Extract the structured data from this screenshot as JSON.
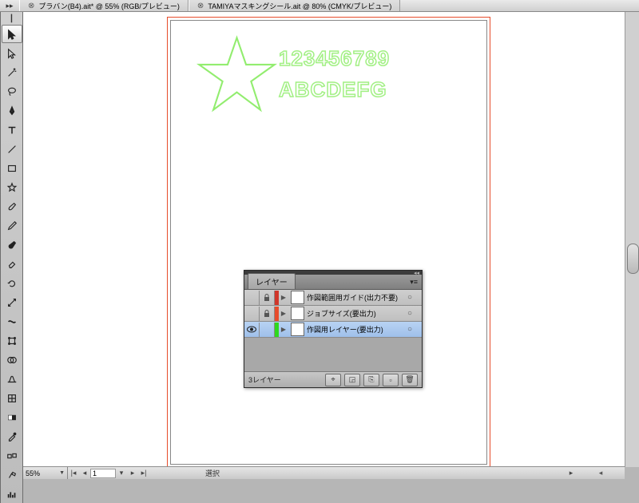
{
  "tabs": [
    {
      "label": "プラバン(B4).ait* @ 55% (RGB/プレビュー)"
    },
    {
      "label": "TAMIYAマスキングシール.ait @ 80% (CMYK/プレビュー)"
    }
  ],
  "topbar_expand": "▸▸",
  "artwork": {
    "line1": "123456789",
    "line2": "ABCDEFG"
  },
  "layers_panel": {
    "title": "レイヤー",
    "rows": [
      {
        "name": "作図範囲用ガイド(出力不要)",
        "color": "#d0362a",
        "locked": true,
        "visible": false,
        "selected": false
      },
      {
        "name": "ジョブサイズ(要出力)",
        "color": "#e74c2b",
        "locked": true,
        "visible": false,
        "selected": false
      },
      {
        "name": "作図用レイヤー(要出力)",
        "color": "#2fd81f",
        "locked": false,
        "visible": true,
        "selected": true
      }
    ],
    "footer_label": "3レイヤー",
    "collapse": "◂◂"
  },
  "statusbar": {
    "zoom": "55%",
    "page": "1",
    "label": "選択"
  },
  "icons": {
    "eye": "◉",
    "lock": "🔒",
    "triangle": "▶",
    "target": "○",
    "menu": "▾"
  }
}
